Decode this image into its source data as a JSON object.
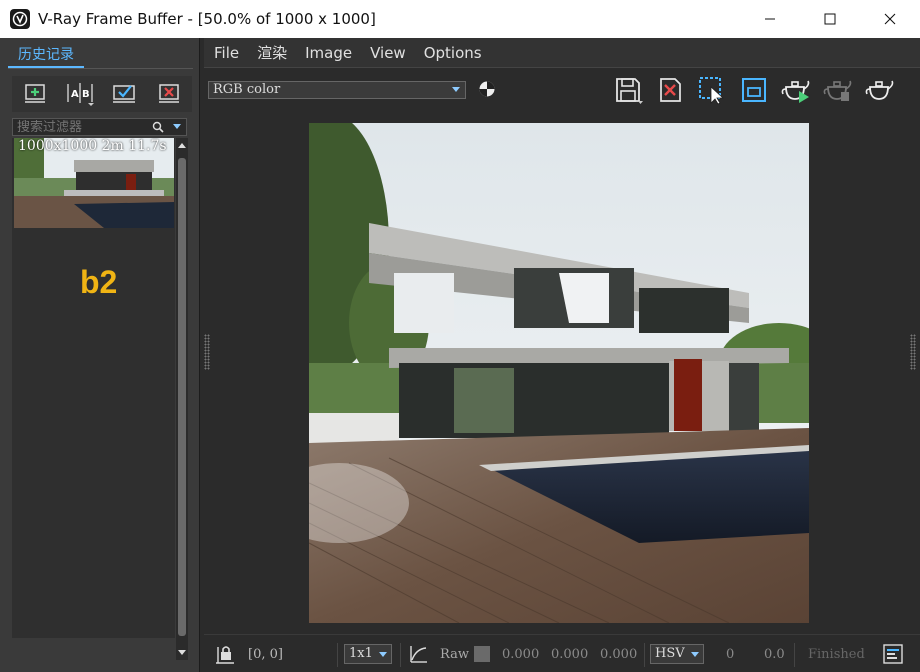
{
  "window": {
    "title": "V-Ray Frame Buffer - [50.0% of 1000 x 1000]"
  },
  "history": {
    "tab_label": "历史记录",
    "filter_placeholder": "搜索过滤器",
    "items": [
      {
        "label": "1000x1000 2m 11.7s"
      }
    ],
    "badge_text": "b2"
  },
  "menu": {
    "items": [
      "File",
      "渲染",
      "Image",
      "View",
      "Options"
    ]
  },
  "toolbar": {
    "channel_value": "RGB color"
  },
  "status": {
    "coords": "[0, 0]",
    "zoom_value": "1x1",
    "raw_label": "Raw",
    "r_value": "0.000",
    "g_value": "0.000",
    "b_value": "0.000",
    "color_space_value": "HSV",
    "h_value": "0",
    "s_value": "0.0",
    "state_text": "Finished"
  },
  "colors": {
    "accent": "#5cb8ff",
    "badge": "#f0b414",
    "panel_bg": "#3a3a3a",
    "viewport_bg": "#2b2b2b"
  }
}
